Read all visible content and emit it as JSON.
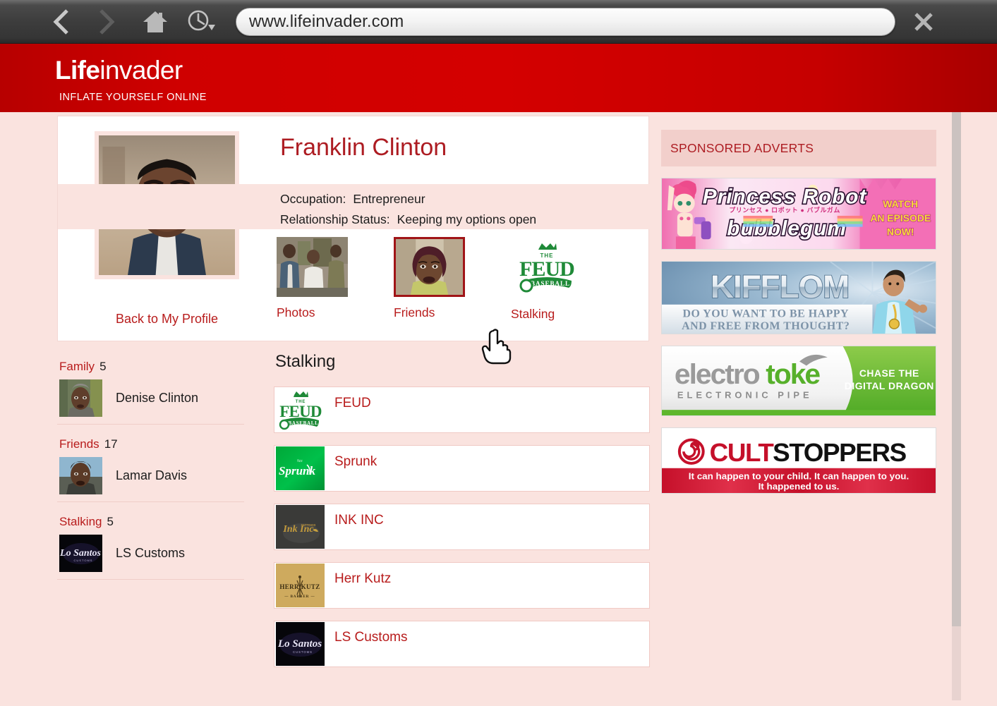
{
  "browser": {
    "url": "www.lifeinvader.com",
    "back_icon": "chevron-left-icon",
    "forward_icon": "chevron-right-icon",
    "home_icon": "home-icon",
    "history_icon": "clock-history-icon",
    "close_icon": "close-x-icon"
  },
  "site": {
    "logo_bold": "Life",
    "logo_thin": "invader",
    "tagline": "INFLATE YOURSELF ONLINE",
    "brand_red": "#cf0000",
    "link_red": "#b81c1c",
    "page_bg": "#fae3df"
  },
  "profile": {
    "name": "Franklin Clinton",
    "back_link": "Back to My Profile",
    "occupation_label": "Occupation:",
    "occupation_value": "Entrepreneur",
    "relationship_label": "Relationship Status:",
    "relationship_value": "Keeping my options open",
    "tiles": [
      {
        "label": "Photos",
        "thumb": "group-photo-thumbnail"
      },
      {
        "label": "Friends",
        "thumb": "tanisha-portrait-thumbnail",
        "selected": true
      },
      {
        "label": "Stalking",
        "thumb": "feud-baseball-logo"
      }
    ]
  },
  "sidebar": {
    "groups": [
      {
        "title": "Family",
        "count": "5",
        "items": [
          {
            "name": "Denise Clinton",
            "thumb": "denise-portrait-thumbnail"
          }
        ]
      },
      {
        "title": "Friends",
        "count": "17",
        "items": [
          {
            "name": "Lamar Davis",
            "thumb": "lamar-portrait-thumbnail"
          }
        ]
      },
      {
        "title": "Stalking",
        "count": "5",
        "items": [
          {
            "name": "LS Customs",
            "thumb": "ls-customs-logo"
          }
        ]
      }
    ]
  },
  "main": {
    "title": "Stalking",
    "items": [
      {
        "name": "FEUD",
        "logo": "feud-baseball-logo"
      },
      {
        "name": "Sprunk",
        "logo": "sprunk-logo"
      },
      {
        "name": "INK INC",
        "logo": "ink-inc-logo"
      },
      {
        "name": "Herr Kutz",
        "logo": "herr-kutz-logo"
      },
      {
        "name": "LS Customs",
        "logo": "ls-customs-logo"
      }
    ]
  },
  "adverts": {
    "header": "SPONSORED ADVERTS",
    "slots": [
      {
        "id": "princess-robot-bubblegum",
        "title_line1": "Princess Robot",
        "title_line2": "bubblegum",
        "subtitle": "プリンセス ● ロボット ● バブルガム",
        "cta_line1": "WATCH",
        "cta_line2": "AN EPISODE",
        "cta_line3": "NOW!"
      },
      {
        "id": "kifflom",
        "title": "KIFFLOM",
        "tagline_line1": "DO YOU WANT TO BE HAPPY",
        "tagline_line2": "AND FREE FROM THOUGHT?"
      },
      {
        "id": "electrotoke",
        "title_part1": "electro",
        "title_part2": "toke",
        "subtitle": "E L E C T R O N I C   P I P E",
        "cta_line1": "CHASE THE",
        "cta_line2": "DIGITAL DRAGON"
      },
      {
        "id": "cultstoppers",
        "title_part1": "CULT",
        "title_part2": "STOPPERS",
        "tagline_line1": "It can happen to your child.  It can happen to you.",
        "tagline_line2": "It happened to us."
      }
    ]
  }
}
